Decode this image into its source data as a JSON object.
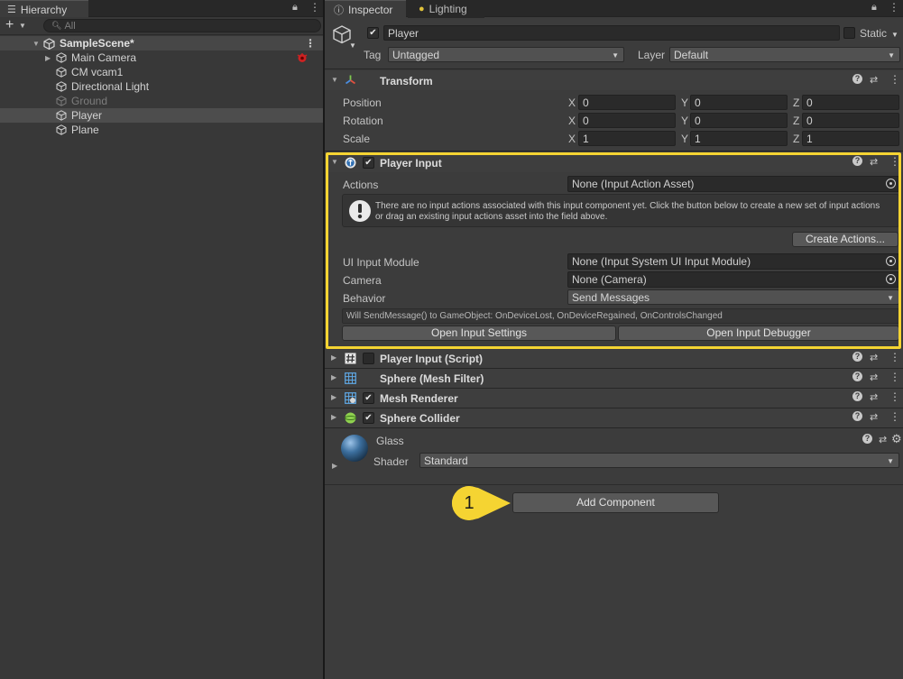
{
  "hierarchy": {
    "tab_label": "Hierarchy",
    "search_placeholder": "All",
    "scene_name": "SampleScene*",
    "items": [
      {
        "label": "Main Camera"
      },
      {
        "label": "CM vcam1"
      },
      {
        "label": "Directional Light"
      },
      {
        "label": "Ground"
      },
      {
        "label": "Player"
      },
      {
        "label": "Plane"
      }
    ]
  },
  "inspector": {
    "tabs": [
      {
        "label": "Inspector"
      },
      {
        "label": "Lighting"
      }
    ],
    "object_name": "Player",
    "static_label": "Static",
    "tag_label": "Tag",
    "tag_value": "Untagged",
    "layer_label": "Layer",
    "layer_value": "Default",
    "transform": {
      "title": "Transform",
      "rows": [
        {
          "label": "Position",
          "x": "0",
          "y": "0",
          "z": "0"
        },
        {
          "label": "Rotation",
          "x": "0",
          "y": "0",
          "z": "0"
        },
        {
          "label": "Scale",
          "x": "1",
          "y": "1",
          "z": "1"
        }
      ],
      "axis_x": "X",
      "axis_y": "Y",
      "axis_z": "Z"
    },
    "player_input": {
      "title": "Player Input",
      "actions_label": "Actions",
      "actions_value": "None (Input Action Asset)",
      "help_text": "There are no input actions associated with this input component yet. Click the button below to create a new set of input actions or drag an existing input actions asset into the field above.",
      "create_actions_button": "Create Actions...",
      "ui_input_module_label": "UI Input Module",
      "ui_input_module_value": "None (Input System UI Input Module)",
      "camera_label": "Camera",
      "camera_value": "None (Camera)",
      "behavior_label": "Behavior",
      "behavior_value": "Send Messages",
      "send_message_info": "Will SendMessage() to GameObject: OnDeviceLost, OnDeviceRegained, OnControlsChanged",
      "open_settings_button": "Open Input Settings",
      "open_debugger_button": "Open Input Debugger"
    },
    "components": [
      {
        "title": "Player Input (Script)"
      },
      {
        "title": "Sphere (Mesh Filter)"
      },
      {
        "title": "Mesh Renderer"
      },
      {
        "title": "Sphere Collider"
      }
    ],
    "material": {
      "name": "Glass",
      "shader_label": "Shader",
      "shader_value": "Standard"
    },
    "add_component_button": "Add Component",
    "step_badge": "1"
  },
  "colors": {
    "highlight": "#f5d432",
    "badge": "#f5d432"
  }
}
